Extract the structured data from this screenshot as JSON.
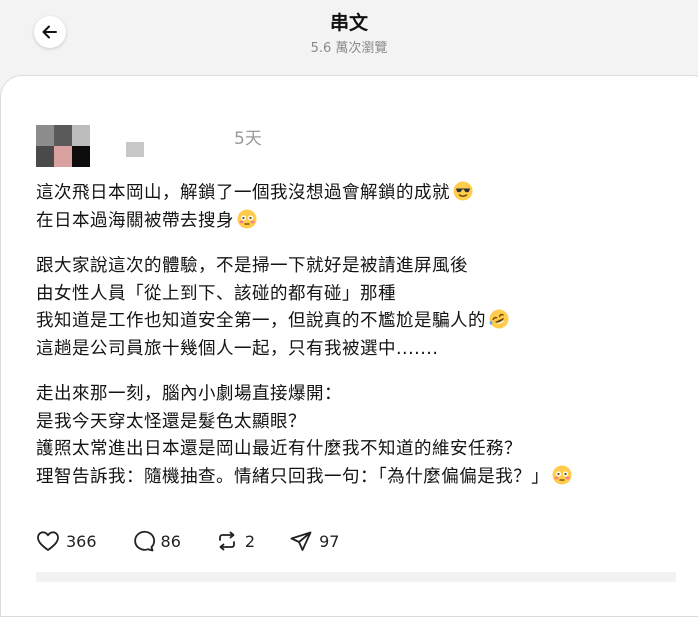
{
  "header": {
    "title": "串文",
    "views": "5.6 萬次瀏覽"
  },
  "post": {
    "timestamp": "5天",
    "paragraphs": [
      {
        "lines": [
          {
            "text": "這次飛日本岡山，解鎖了一個我沒想過會解鎖的成就",
            "emoji": "sunglasses-emoji"
          },
          {
            "text": "在日本過海關被帶去搜身",
            "emoji": "flushed-emoji"
          }
        ]
      },
      {
        "lines": [
          {
            "text": "跟大家說這次的體驗，不是掃一下就好是被請進屏風後",
            "emoji": ""
          },
          {
            "text": "由女性人員「從上到下、該碰的都有碰」那種",
            "emoji": ""
          },
          {
            "text": "我知道是工作也知道安全第一，但說真的不尷尬是騙人的",
            "emoji": "rofl-emoji"
          },
          {
            "text": "這趟是公司員旅十幾個人一起，只有我被選中.......",
            "emoji": ""
          }
        ]
      },
      {
        "lines": [
          {
            "text": "走出來那一刻，腦內小劇場直接爆開：",
            "emoji": ""
          },
          {
            "text": "是我今天穿太怪還是髮色太顯眼？",
            "emoji": ""
          },
          {
            "text": "護照太常進出日本還是岡山最近有什麼我不知道的維安任務？",
            "emoji": ""
          },
          {
            "text": "理智告訴我：隨機抽查。情緒只回我一句：「為什麼偏偏是我？」",
            "emoji": "flushed-emoji"
          }
        ]
      }
    ],
    "actions": {
      "likes": "366",
      "comments": "86",
      "reposts": "2",
      "shares": "97"
    }
  },
  "colors": {
    "background": "#f3f3f3",
    "card": "#ffffff",
    "muted_text": "#9a9a9a",
    "emoji_yellow": "#ffcc4d"
  }
}
